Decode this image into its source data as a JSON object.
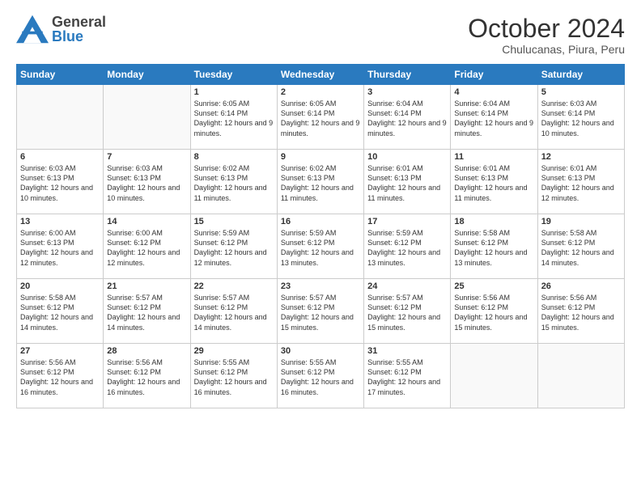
{
  "header": {
    "logo_general": "General",
    "logo_blue": "Blue",
    "month_title": "October 2024",
    "subtitle": "Chulucanas, Piura, Peru"
  },
  "days_of_week": [
    "Sunday",
    "Monday",
    "Tuesday",
    "Wednesday",
    "Thursday",
    "Friday",
    "Saturday"
  ],
  "weeks": [
    [
      {
        "day": "",
        "info": ""
      },
      {
        "day": "",
        "info": ""
      },
      {
        "day": "1",
        "info": "Sunrise: 6:05 AM\nSunset: 6:14 PM\nDaylight: 12 hours and 9 minutes."
      },
      {
        "day": "2",
        "info": "Sunrise: 6:05 AM\nSunset: 6:14 PM\nDaylight: 12 hours and 9 minutes."
      },
      {
        "day": "3",
        "info": "Sunrise: 6:04 AM\nSunset: 6:14 PM\nDaylight: 12 hours and 9 minutes."
      },
      {
        "day": "4",
        "info": "Sunrise: 6:04 AM\nSunset: 6:14 PM\nDaylight: 12 hours and 9 minutes."
      },
      {
        "day": "5",
        "info": "Sunrise: 6:03 AM\nSunset: 6:14 PM\nDaylight: 12 hours and 10 minutes."
      }
    ],
    [
      {
        "day": "6",
        "info": "Sunrise: 6:03 AM\nSunset: 6:13 PM\nDaylight: 12 hours and 10 minutes."
      },
      {
        "day": "7",
        "info": "Sunrise: 6:03 AM\nSunset: 6:13 PM\nDaylight: 12 hours and 10 minutes."
      },
      {
        "day": "8",
        "info": "Sunrise: 6:02 AM\nSunset: 6:13 PM\nDaylight: 12 hours and 11 minutes."
      },
      {
        "day": "9",
        "info": "Sunrise: 6:02 AM\nSunset: 6:13 PM\nDaylight: 12 hours and 11 minutes."
      },
      {
        "day": "10",
        "info": "Sunrise: 6:01 AM\nSunset: 6:13 PM\nDaylight: 12 hours and 11 minutes."
      },
      {
        "day": "11",
        "info": "Sunrise: 6:01 AM\nSunset: 6:13 PM\nDaylight: 12 hours and 11 minutes."
      },
      {
        "day": "12",
        "info": "Sunrise: 6:01 AM\nSunset: 6:13 PM\nDaylight: 12 hours and 12 minutes."
      }
    ],
    [
      {
        "day": "13",
        "info": "Sunrise: 6:00 AM\nSunset: 6:13 PM\nDaylight: 12 hours and 12 minutes."
      },
      {
        "day": "14",
        "info": "Sunrise: 6:00 AM\nSunset: 6:12 PM\nDaylight: 12 hours and 12 minutes."
      },
      {
        "day": "15",
        "info": "Sunrise: 5:59 AM\nSunset: 6:12 PM\nDaylight: 12 hours and 12 minutes."
      },
      {
        "day": "16",
        "info": "Sunrise: 5:59 AM\nSunset: 6:12 PM\nDaylight: 12 hours and 13 minutes."
      },
      {
        "day": "17",
        "info": "Sunrise: 5:59 AM\nSunset: 6:12 PM\nDaylight: 12 hours and 13 minutes."
      },
      {
        "day": "18",
        "info": "Sunrise: 5:58 AM\nSunset: 6:12 PM\nDaylight: 12 hours and 13 minutes."
      },
      {
        "day": "19",
        "info": "Sunrise: 5:58 AM\nSunset: 6:12 PM\nDaylight: 12 hours and 14 minutes."
      }
    ],
    [
      {
        "day": "20",
        "info": "Sunrise: 5:58 AM\nSunset: 6:12 PM\nDaylight: 12 hours and 14 minutes."
      },
      {
        "day": "21",
        "info": "Sunrise: 5:57 AM\nSunset: 6:12 PM\nDaylight: 12 hours and 14 minutes."
      },
      {
        "day": "22",
        "info": "Sunrise: 5:57 AM\nSunset: 6:12 PM\nDaylight: 12 hours and 14 minutes."
      },
      {
        "day": "23",
        "info": "Sunrise: 5:57 AM\nSunset: 6:12 PM\nDaylight: 12 hours and 15 minutes."
      },
      {
        "day": "24",
        "info": "Sunrise: 5:57 AM\nSunset: 6:12 PM\nDaylight: 12 hours and 15 minutes."
      },
      {
        "day": "25",
        "info": "Sunrise: 5:56 AM\nSunset: 6:12 PM\nDaylight: 12 hours and 15 minutes."
      },
      {
        "day": "26",
        "info": "Sunrise: 5:56 AM\nSunset: 6:12 PM\nDaylight: 12 hours and 15 minutes."
      }
    ],
    [
      {
        "day": "27",
        "info": "Sunrise: 5:56 AM\nSunset: 6:12 PM\nDaylight: 12 hours and 16 minutes."
      },
      {
        "day": "28",
        "info": "Sunrise: 5:56 AM\nSunset: 6:12 PM\nDaylight: 12 hours and 16 minutes."
      },
      {
        "day": "29",
        "info": "Sunrise: 5:55 AM\nSunset: 6:12 PM\nDaylight: 12 hours and 16 minutes."
      },
      {
        "day": "30",
        "info": "Sunrise: 5:55 AM\nSunset: 6:12 PM\nDaylight: 12 hours and 16 minutes."
      },
      {
        "day": "31",
        "info": "Sunrise: 5:55 AM\nSunset: 6:12 PM\nDaylight: 12 hours and 17 minutes."
      },
      {
        "day": "",
        "info": ""
      },
      {
        "day": "",
        "info": ""
      }
    ]
  ]
}
